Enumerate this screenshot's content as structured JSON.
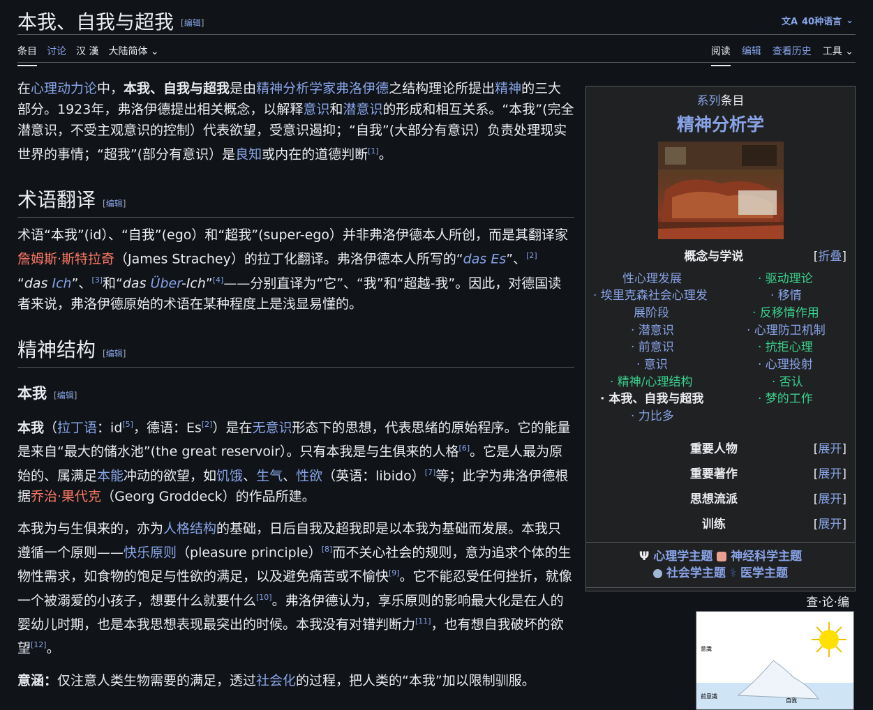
{
  "header": {
    "title": "本我、自我与超我",
    "edit_label": "编辑",
    "lang_label": "40种语言"
  },
  "tabs_left": [
    "条目",
    "讨论",
    "汉 漢",
    "大陆简体"
  ],
  "tabs_right": [
    "阅读",
    "编辑",
    "查看历史",
    "工具"
  ],
  "intro": {
    "t1": "在",
    "l1": "心理动力论",
    "t2": "中，",
    "b1": "本我、自我与超我",
    "t3": "是由",
    "l2": "精神分析学家弗洛伊德",
    "t4": "之结构理论所提出",
    "l3": "精神",
    "t5": "的三大部分。1923年，弗洛伊德提出相关概念，以解释",
    "l4": "意识",
    "t6": "和",
    "l5": "潜意识",
    "t7": "的形成和相互关系。“本我”(完全潜意识，不受主观意识的控制）代表欲望，受意识遏抑；“自我”(大部分有意识）负责处理现实世界的事情；“超我”(部分有意识）是",
    "l6": "良知",
    "t8": "或内在的道德判断",
    "r1": "[1]",
    "t9": "。"
  },
  "sec1": {
    "heading": "术语翻译",
    "edit": "编辑",
    "t1": "术语“本我”(id）、“自我”(ego）和“超我”(super-ego）并非弗洛伊德本人所创，而是其翻译家",
    "l1": "詹姆斯·斯特拉奇",
    "t2": "（James Strachey）的拉丁化翻译。弗洛伊德本人所写的“",
    "i1": "das Es",
    "t3": "”、",
    "r2": "[2]",
    "t4": "“",
    "i2a": "das ",
    "i2b": "Ich",
    "t5": "”、",
    "r3": "[3]",
    "t6": "和“",
    "i3a": "das ",
    "i3b": "Über",
    "i3c": "-Ich",
    "t7": "”",
    "r4": "[4]",
    "t8": "——分别直译为“它”、“我”和“超越-我”。因此，对德国读者来说，弗洛伊德原始的术语在某种程度上是浅显易懂的。"
  },
  "sec2": {
    "heading": "精神结构",
    "edit": "编辑",
    "sub": "本我",
    "sub_edit": "编辑",
    "p1": {
      "b1": "本我",
      "t1": "（",
      "l1": "拉丁语",
      "t2": "：id",
      "r5": "[5]",
      "t3": "，德语：Es",
      "r2": "[2]",
      "t4": "）是在",
      "l2": "无意识",
      "t5": "形态下的思想，代表思绪的原始程序。它的能量是来自“最大的储水池”(the great reservoir）。只有本我是与生俱来的人格",
      "r6": "[6]",
      "t6": "。它是人最为原始的、属满足",
      "l3": "本能",
      "t7": "冲动的欲望，如",
      "l4": "饥饿",
      "t8": "、",
      "l5": "生气",
      "t9": "、",
      "l6": "性欲",
      "t10": "（英语：libido）",
      "r7": "[7]",
      "t11": "等；此字为弗洛伊德根据",
      "l7": "乔治·果代克",
      "t12": "（Georg Groddeck）的作品所建。"
    },
    "p2": {
      "t1": "本我为与生俱来的，亦为",
      "l1": "人格结构",
      "t2": "的基础，日后自我及超我即是以本我为基础而发展。本我只遵循一个原则——",
      "l2": "快乐原则",
      "t3": "（pleasure principle）",
      "r8": "[8]",
      "t4": "而不关心社会的规则，意为追求个体的生物性需求，如食物的饱足与性欲的满足，以及避免痛苦或不愉快",
      "r9": "[9]",
      "t5": "。它不能忍受任何挫折，就像一个被溺爱的小孩子，想要什么就要什么",
      "r10": "[10]",
      "t6": "。弗洛伊德认为，享乐原则的影响最大化是在人的婴幼儿时期，也是本我思想表现最突出的时候。本我没有对错判断力",
      "r11": "[11]",
      "t7": "，也有想自我破坏的欲望",
      "r12": "[12]",
      "t8": "。"
    },
    "p3": {
      "b1": "意涵：",
      "t1": "仅注意人类生物需要的满足，透过",
      "l1": "社会化",
      "t2": "的过程，把人类的“本我”加以限制驯服。"
    }
  },
  "infobox": {
    "series_link": "系列",
    "series_text": "条目",
    "title": "精神分析学",
    "sec_concepts": "概念与学说",
    "collapse": "折叠",
    "expand": "展开",
    "left_items": [
      "性心理发展",
      "· 埃里克森社会心理发",
      "展阶段",
      "· 潜意识",
      "· 前意识",
      "· 意识",
      "· 精神/心理结构",
      "· 本我、自我与超我",
      "· 力比多"
    ],
    "right_items": [
      "· 驱动理论",
      "· 移情",
      "· 反移情作用",
      "· 心理防卫机制",
      "· 抗拒心理",
      "· 心理投射",
      "· 否认",
      "· 梦的工作"
    ],
    "sections": [
      "重要人物",
      "重要著作",
      "思想流派",
      "训练"
    ],
    "portals": [
      "心理学主题",
      "神经科学主题",
      "社会学主题",
      "医学主题"
    ],
    "footer": "查·论·编"
  },
  "iceberg": {
    "label1": "意識",
    "label2": "前意識",
    "label3": "自我"
  },
  "colors": {
    "link": "#88a3e8",
    "redlink": "#fd7865",
    "green": "#3ad18e",
    "bg": "#101418"
  }
}
